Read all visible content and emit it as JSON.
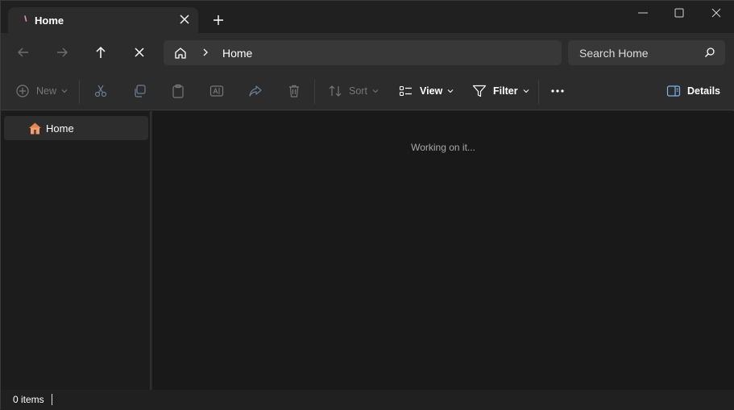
{
  "tab": {
    "title": "Home"
  },
  "address": {
    "path": "Home"
  },
  "search": {
    "placeholder": "Search Home"
  },
  "toolbar": {
    "new_label": "New",
    "sort_label": "Sort",
    "view_label": "View",
    "filter_label": "Filter",
    "details_label": "Details"
  },
  "sidebar": {
    "items": [
      {
        "label": "Home",
        "icon": "home-icon"
      }
    ]
  },
  "content": {
    "status_message": "Working on it..."
  },
  "statusbar": {
    "items_count": "0 items"
  },
  "colors": {
    "background": "#202020",
    "content": "#191919",
    "home_icon": "#e8834d"
  }
}
